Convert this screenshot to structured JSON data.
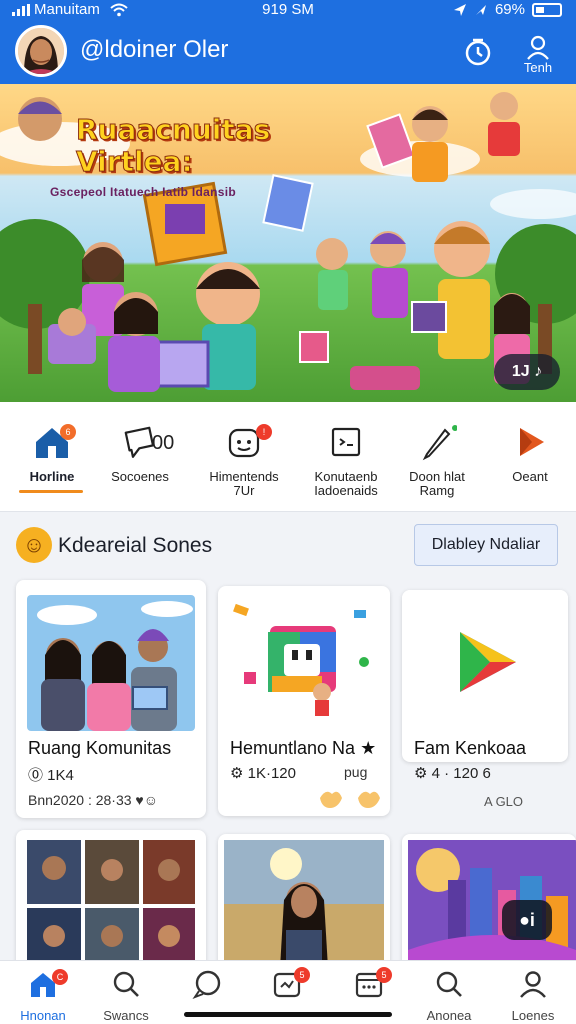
{
  "status": {
    "carrier": "Manuitam",
    "time": "919 SM",
    "battery": "69%"
  },
  "header": {
    "title": "@ldoiner Oler",
    "profile_label": "Tenh"
  },
  "banner": {
    "title_line1": "Ruaacnuitas",
    "title_line2": "Virtlea:",
    "subtitle": "Gscepeol Itatuech Iatib Idansib",
    "badge": "1J ♪"
  },
  "nav": {
    "items": [
      {
        "label": "Horline",
        "badge": "6"
      },
      {
        "label": "Socoenes",
        "extra": "00"
      },
      {
        "label": "Himentends\n7Ur"
      },
      {
        "label": "Konutaenb\nIadoenaids"
      },
      {
        "label": "Doon hlat\nRamg"
      },
      {
        "label": "Oeant"
      }
    ]
  },
  "section": {
    "emoji": "☺",
    "title": "Kdeareial Sones",
    "button": "Dlabley Ndaliar"
  },
  "cards": [
    {
      "title": "Ruang Komunitas",
      "meta": "⓪ 1K4",
      "foot": "Bnn2020 : 28·33 ♥☺"
    },
    {
      "title": "Hemuntlano Na ★",
      "meta": "⚙ 1K·120",
      "foot_right": "puɡ"
    },
    {
      "title": "Fam Kenkoaa",
      "meta": "⚙ 4 · 120 6",
      "foot_right": "A  GLO"
    }
  ],
  "video_badge": "●i",
  "tabs": [
    {
      "label": "Hnonan",
      "active": true,
      "badge": "C"
    },
    {
      "label": "Swancs"
    },
    {
      "label": ""
    },
    {
      "label": "",
      "badge": "5"
    },
    {
      "label": "",
      "badge": "5"
    },
    {
      "label": "Anonea"
    },
    {
      "label": "Loenes"
    }
  ],
  "colors": {
    "brand": "#1e6fe0",
    "accent": "#f08b1c",
    "badge": "#ee3b2b"
  }
}
